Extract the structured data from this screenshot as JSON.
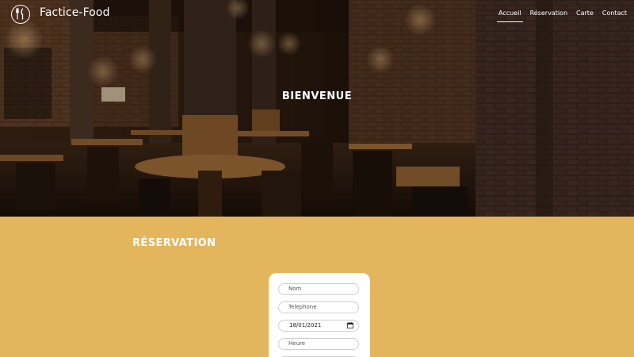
{
  "header": {
    "brand": "Factice-Food",
    "nav": [
      "Accueil",
      "Réservation",
      "Carte",
      "Contact"
    ]
  },
  "hero": {
    "title": "BIENVENUE"
  },
  "reservation": {
    "title": "RÉSERVATION",
    "fields": {
      "name_placeholder": "Nom",
      "phone_placeholder": "Telephone",
      "date_value": "18/01/2021",
      "time_placeholder": "Heure"
    }
  },
  "colors": {
    "section_bg": "#e3b65e",
    "text_light": "#ffffff"
  },
  "icons": {
    "logo": "fork-knife-icon",
    "date": "calendar-icon"
  }
}
